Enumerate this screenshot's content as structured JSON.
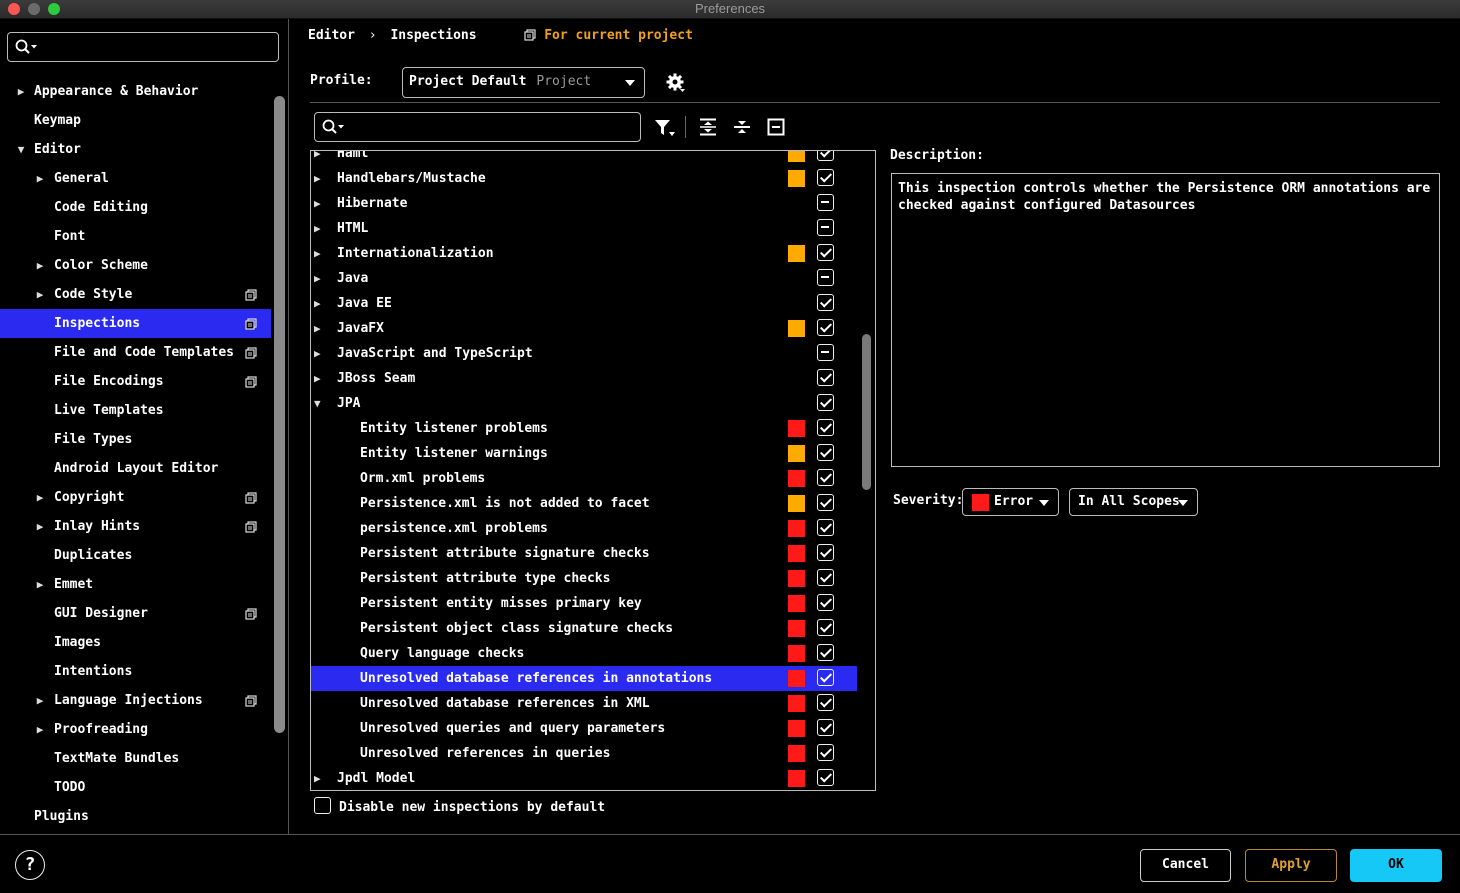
{
  "window": {
    "title": "Preferences"
  },
  "sidebar": {
    "search_placeholder": "",
    "items": [
      {
        "label": "Appearance & Behavior",
        "level": 0,
        "expander": "collapsed",
        "copy": false,
        "selected": false
      },
      {
        "label": "Keymap",
        "level": 0,
        "expander": "none",
        "copy": false,
        "selected": false
      },
      {
        "label": "Editor",
        "level": 0,
        "expander": "expanded",
        "copy": false,
        "selected": false
      },
      {
        "label": "General",
        "level": 1,
        "expander": "collapsed",
        "copy": false,
        "selected": false
      },
      {
        "label": "Code Editing",
        "level": 1,
        "expander": "none",
        "copy": false,
        "selected": false
      },
      {
        "label": "Font",
        "level": 1,
        "expander": "none",
        "copy": false,
        "selected": false
      },
      {
        "label": "Color Scheme",
        "level": 1,
        "expander": "collapsed",
        "copy": false,
        "selected": false
      },
      {
        "label": "Code Style",
        "level": 1,
        "expander": "collapsed",
        "copy": true,
        "selected": false
      },
      {
        "label": "Inspections",
        "level": 1,
        "expander": "none",
        "copy": true,
        "selected": true
      },
      {
        "label": "File and Code Templates",
        "level": 1,
        "expander": "none",
        "copy": true,
        "selected": false
      },
      {
        "label": "File Encodings",
        "level": 1,
        "expander": "none",
        "copy": true,
        "selected": false
      },
      {
        "label": "Live Templates",
        "level": 1,
        "expander": "none",
        "copy": false,
        "selected": false
      },
      {
        "label": "File Types",
        "level": 1,
        "expander": "none",
        "copy": false,
        "selected": false
      },
      {
        "label": "Android Layout Editor",
        "level": 1,
        "expander": "none",
        "copy": false,
        "selected": false
      },
      {
        "label": "Copyright",
        "level": 1,
        "expander": "collapsed",
        "copy": true,
        "selected": false
      },
      {
        "label": "Inlay Hints",
        "level": 1,
        "expander": "collapsed",
        "copy": true,
        "selected": false
      },
      {
        "label": "Duplicates",
        "level": 1,
        "expander": "none",
        "copy": false,
        "selected": false
      },
      {
        "label": "Emmet",
        "level": 1,
        "expander": "collapsed",
        "copy": false,
        "selected": false
      },
      {
        "label": "GUI Designer",
        "level": 1,
        "expander": "none",
        "copy": true,
        "selected": false
      },
      {
        "label": "Images",
        "level": 1,
        "expander": "none",
        "copy": false,
        "selected": false
      },
      {
        "label": "Intentions",
        "level": 1,
        "expander": "none",
        "copy": false,
        "selected": false
      },
      {
        "label": "Language Injections",
        "level": 1,
        "expander": "collapsed",
        "copy": true,
        "selected": false
      },
      {
        "label": "Proofreading",
        "level": 1,
        "expander": "collapsed",
        "copy": false,
        "selected": false
      },
      {
        "label": "TextMate Bundles",
        "level": 1,
        "expander": "none",
        "copy": false,
        "selected": false
      },
      {
        "label": "TODO",
        "level": 1,
        "expander": "none",
        "copy": false,
        "selected": false
      },
      {
        "label": "Plugins",
        "level": 0,
        "expander": "none",
        "copy": false,
        "selected": false
      }
    ]
  },
  "breadcrumb": {
    "parent": "Editor",
    "separator": "›",
    "current": "Inspections",
    "scope_note": "For current project"
  },
  "profile": {
    "label": "Profile:",
    "value": "Project Default",
    "sub": "Project"
  },
  "inspections": {
    "search_placeholder": "",
    "rows": [
      {
        "label": "Haml",
        "level": 0,
        "expander": "collapsed",
        "severity": "warning",
        "check": "checked",
        "selected": false
      },
      {
        "label": "Handlebars/Mustache",
        "level": 0,
        "expander": "collapsed",
        "severity": "warning",
        "check": "checked",
        "selected": false
      },
      {
        "label": "Hibernate",
        "level": 0,
        "expander": "collapsed",
        "severity": "none",
        "check": "mixed",
        "selected": false
      },
      {
        "label": "HTML",
        "level": 0,
        "expander": "collapsed",
        "severity": "none",
        "check": "mixed",
        "selected": false
      },
      {
        "label": "Internationalization",
        "level": 0,
        "expander": "collapsed",
        "severity": "warning",
        "check": "checked",
        "selected": false
      },
      {
        "label": "Java",
        "level": 0,
        "expander": "collapsed",
        "severity": "none",
        "check": "mixed",
        "selected": false
      },
      {
        "label": "Java EE",
        "level": 0,
        "expander": "collapsed",
        "severity": "none",
        "check": "checked",
        "selected": false
      },
      {
        "label": "JavaFX",
        "level": 0,
        "expander": "collapsed",
        "severity": "warning",
        "check": "checked",
        "selected": false
      },
      {
        "label": "JavaScript and TypeScript",
        "level": 0,
        "expander": "collapsed",
        "severity": "none",
        "check": "mixed",
        "selected": false
      },
      {
        "label": "JBoss Seam",
        "level": 0,
        "expander": "collapsed",
        "severity": "none",
        "check": "checked",
        "selected": false
      },
      {
        "label": "JPA",
        "level": 0,
        "expander": "expanded",
        "severity": "none",
        "check": "checked",
        "selected": false
      },
      {
        "label": "Entity listener problems",
        "level": 1,
        "expander": "none",
        "severity": "error",
        "check": "checked",
        "selected": false
      },
      {
        "label": "Entity listener warnings",
        "level": 1,
        "expander": "none",
        "severity": "warning",
        "check": "checked",
        "selected": false
      },
      {
        "label": "Orm.xml problems",
        "level": 1,
        "expander": "none",
        "severity": "error",
        "check": "checked",
        "selected": false
      },
      {
        "label": "Persistence.xml is not added to facet",
        "level": 1,
        "expander": "none",
        "severity": "warning",
        "check": "checked",
        "selected": false
      },
      {
        "label": "persistence.xml problems",
        "level": 1,
        "expander": "none",
        "severity": "error",
        "check": "checked",
        "selected": false
      },
      {
        "label": "Persistent attribute signature checks",
        "level": 1,
        "expander": "none",
        "severity": "error",
        "check": "checked",
        "selected": false
      },
      {
        "label": "Persistent attribute type checks",
        "level": 1,
        "expander": "none",
        "severity": "error",
        "check": "checked",
        "selected": false
      },
      {
        "label": "Persistent entity misses primary key",
        "level": 1,
        "expander": "none",
        "severity": "error",
        "check": "checked",
        "selected": false
      },
      {
        "label": "Persistent object class signature checks",
        "level": 1,
        "expander": "none",
        "severity": "error",
        "check": "checked",
        "selected": false
      },
      {
        "label": "Query language checks",
        "level": 1,
        "expander": "none",
        "severity": "error",
        "check": "checked",
        "selected": false
      },
      {
        "label": "Unresolved database references in annotations",
        "level": 1,
        "expander": "none",
        "severity": "error",
        "check": "checked",
        "selected": true
      },
      {
        "label": "Unresolved database references in XML",
        "level": 1,
        "expander": "none",
        "severity": "error",
        "check": "checked",
        "selected": false
      },
      {
        "label": "Unresolved queries and query parameters",
        "level": 1,
        "expander": "none",
        "severity": "error",
        "check": "checked",
        "selected": false
      },
      {
        "label": "Unresolved references in queries",
        "level": 1,
        "expander": "none",
        "severity": "error",
        "check": "checked",
        "selected": false
      },
      {
        "label": "Jpdl Model",
        "level": 0,
        "expander": "collapsed",
        "severity": "error",
        "check": "checked",
        "selected": false
      }
    ],
    "disable_new_label": "Disable new inspections by default"
  },
  "description": {
    "label": "Description:",
    "text": "This inspection controls whether the Persistence ORM annotations are\nchecked against configured Datasources"
  },
  "severity": {
    "label": "Severity:",
    "value": "Error",
    "scope": "In All Scopes"
  },
  "footer": {
    "help": "?",
    "cancel": "Cancel",
    "apply": "Apply",
    "ok": "OK"
  },
  "colors": {
    "error": "#ff1a1a",
    "warning": "#ffaa00",
    "selection": "#2a2af0",
    "ok_button": "#15c8f5",
    "apply_border": "#b8863a",
    "apply_text": "#e0a030",
    "scope_note": "#f0a020"
  }
}
